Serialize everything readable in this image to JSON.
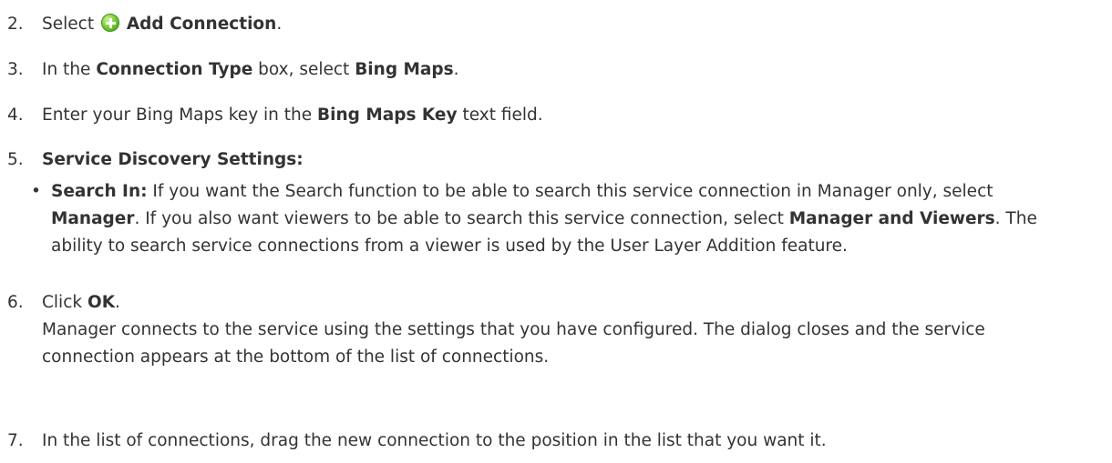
{
  "steps": {
    "s2": {
      "num": "2.",
      "pre": "Select",
      "bold": "Add Connection",
      "post": "."
    },
    "s3": {
      "num": "3.",
      "pre": "In the",
      "bold1": "Connection Type",
      "mid": "box, select",
      "bold2": "Bing Maps",
      "post": "."
    },
    "s4": {
      "num": "4.",
      "pre": "Enter your Bing Maps key in the",
      "bold": "Bing Maps Key",
      "post": "text field."
    },
    "s5": {
      "num": "5.",
      "bold": "Service Discovery Settings:"
    },
    "bullet": {
      "dot": "•",
      "bold1": "Search In:",
      "t1": "If you want the Search function to be able to search this service connection in Manager only, select",
      "bold2": "Manager",
      "t2": ". If you also want viewers to be able to search this service connection, select",
      "bold3": "Manager and Viewers",
      "t3": ". The ability to search service connections from a viewer is used by the User Layer Addition feature."
    },
    "s6": {
      "num": "6.",
      "pre": "Click",
      "bold": "OK",
      "post": ".",
      "desc": "Manager connects to the service using the settings that you have configured. The dialog closes and the service connection appears at the bottom of the list of connections."
    },
    "s7": {
      "num": "7.",
      "text": "In the list of connections, drag the new connection to the position in the list that you want it."
    }
  },
  "icons": {
    "add": "add-connection-icon"
  }
}
